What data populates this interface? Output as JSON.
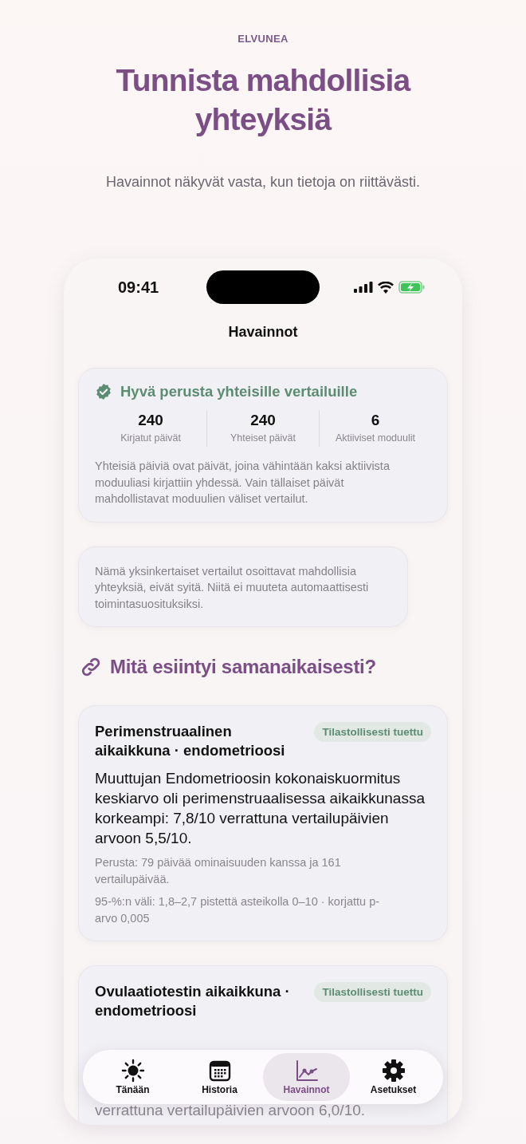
{
  "brand": "ELVUNEA",
  "headline": "Tunnista mahdollisia yhteyksiä",
  "subtitle": "Havainnot näkyvät vasta, kun tietoja on riittävästi.",
  "status_bar": {
    "time": "09:41"
  },
  "nav_title": "Havainnot",
  "basis_card": {
    "title": "Hyvä perusta yhteisille vertailuille",
    "stats": [
      {
        "value": "240",
        "label": "Kirjatut päivät"
      },
      {
        "value": "240",
        "label": "Yhteiset päivät"
      },
      {
        "value": "6",
        "label": "Aktiiviset moduulit"
      }
    ],
    "description": "Yhteisiä päiviä ovat päivät, joina vähintään kaksi aktiivista moduuliasi kirjattiin yhdessä. Vain tällaiset päivät mahdollistavat moduulien väliset vertailut."
  },
  "note": "Nämä yksinkertaiset vertailut osoittavat mahdollisia yhteyksiä, eivät syitä. Niitä ei muuteta automaattisesti toimintasuosituksiksi.",
  "section_title": "Mitä esiintyi samanaikaisesti?",
  "findings": [
    {
      "title": "Perimenstruaalinen aikaikkuna · endometrioosi",
      "badge": "Tilastollisesti tuettu",
      "body": "Muuttujan Endometrioosin kokonaiskuormitus keskiarvo oli perimenstruaalisessa aikaikkunassa korkeampi: 7,8/10 verrattuna vertailupäivien arvoon 5,5/10.",
      "basis": "Perusta: 79 päivää ominaisuuden kanssa ja 161 vertailupäivää.",
      "interval": "95-%:n väli: 1,8–2,7 pistettä asteikolla 0–10 · korjattu p-arvo 0,005"
    },
    {
      "title": "Ovulaatiotestin aikaikkuna · endometrioosi",
      "badge": "Tilastollisesti tuettu",
      "body": "verrattuna vertailupäivien arvoon 6,0/10."
    }
  ],
  "tabs": [
    {
      "label": "Tänään",
      "selected": false
    },
    {
      "label": "Historia",
      "selected": false
    },
    {
      "label": "Havainnot",
      "selected": true
    },
    {
      "label": "Asetukset",
      "selected": false
    }
  ]
}
